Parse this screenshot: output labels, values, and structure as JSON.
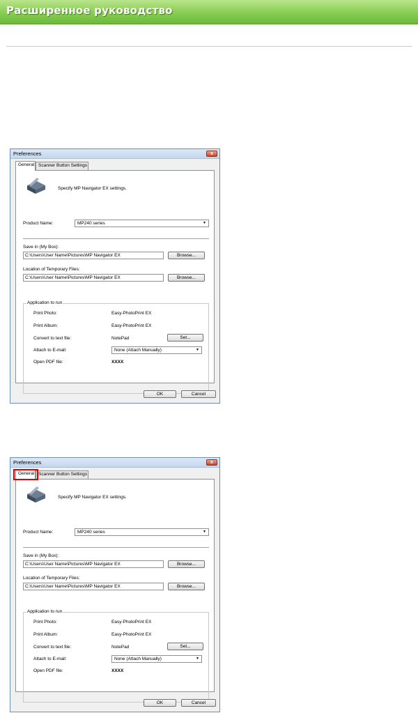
{
  "banner": {
    "title": "Расширенное руководство"
  },
  "dialogs": [
    {
      "title": "Preferences",
      "close_label": "x",
      "tabs": [
        {
          "label": "General"
        },
        {
          "label": "Scanner Button Settings"
        }
      ],
      "header_text": "Specify MP Navigator EX settings.",
      "product_name": {
        "label": "Product Name:",
        "value": "MP240 series"
      },
      "save_in": {
        "label": "Save in (My Box):",
        "value": "C:\\Users\\User Name\\Pictures\\MP Navigator EX",
        "button": "Browse..."
      },
      "temp_files": {
        "label": "Location of Temporary Files:",
        "value": "C:\\Users\\User Name\\Pictures\\MP Navigator EX",
        "button": "Browse..."
      },
      "apps": {
        "title": "Application to run",
        "print_photo": {
          "label": "Print Photo:",
          "value": "Easy-PhotoPrint EX"
        },
        "print_album": {
          "label": "Print Album:",
          "value": "Easy-PhotoPrint EX"
        },
        "convert_text": {
          "label": "Convert to text file:",
          "value": "NotePad",
          "button": "Set..."
        },
        "attach_email": {
          "label": "Attach to E-mail:",
          "value": "None (Attach Manually)"
        },
        "open_pdf": {
          "label": "Open PDF file:",
          "value": "XXXX"
        }
      },
      "ok": "OK",
      "cancel": "Cancel"
    },
    {
      "title": "Preferences",
      "close_label": "x",
      "tabs": [
        {
          "label": "General"
        },
        {
          "label": "Scanner Button Settings"
        }
      ],
      "header_text": "Specify MP Navigator EX settings.",
      "product_name": {
        "label": "Product Name:",
        "value": "MP240 series"
      },
      "save_in": {
        "label": "Save in (My Box):",
        "value": "C:\\Users\\User Name\\Pictures\\MP Navigator EX",
        "button": "Browse..."
      },
      "temp_files": {
        "label": "Location of Temporary Files:",
        "value": "C:\\Users\\User Name\\Pictures\\MP Navigator EX",
        "button": "Browse..."
      },
      "apps": {
        "title": "Application to run",
        "print_photo": {
          "label": "Print Photo:",
          "value": "Easy-PhotoPrint EX"
        },
        "print_album": {
          "label": "Print Album:",
          "value": "Easy-PhotoPrint EX"
        },
        "convert_text": {
          "label": "Convert to text file:",
          "value": "NotePad",
          "button": "Set..."
        },
        "attach_email": {
          "label": "Attach to E-mail:",
          "value": "None (Attach Manually)"
        },
        "open_pdf": {
          "label": "Open PDF file:",
          "value": "XXXX"
        }
      },
      "ok": "OK",
      "cancel": "Cancel"
    }
  ],
  "colors": {
    "banner": "#8fd15a",
    "highlight": "#e00000",
    "dialog_border": "#6d8fb5"
  }
}
